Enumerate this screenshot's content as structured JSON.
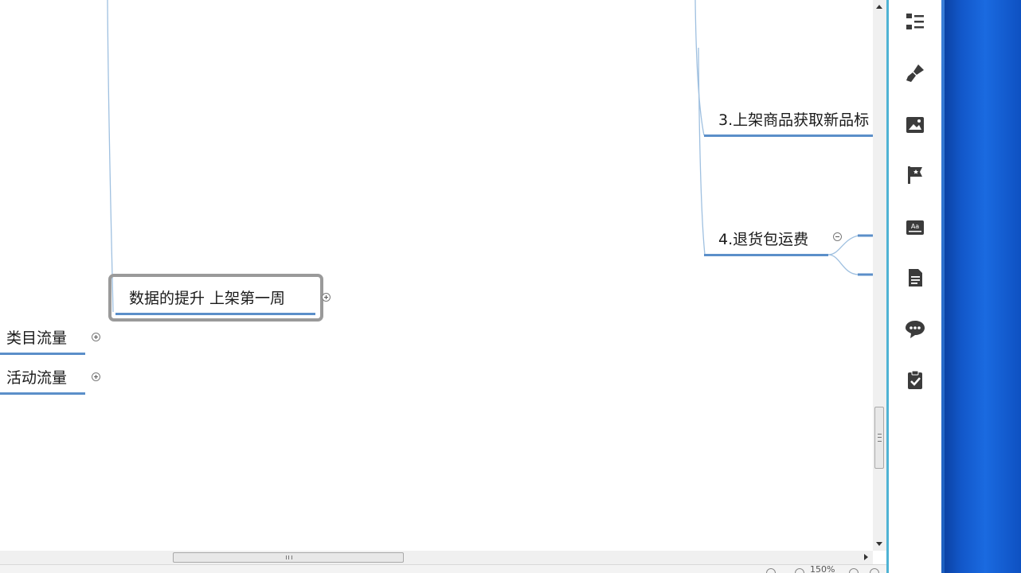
{
  "mindmap": {
    "topics": {
      "central": "数据的提升  上架第一周",
      "category_traffic": "类目流量",
      "activity_traffic": "活动流量",
      "item3": "3.上架商品获取新品标",
      "item4": "4.退货包运费"
    }
  },
  "statusbar": {
    "zoom": "150%"
  },
  "panel": {
    "icons": [
      "outline-icon",
      "format-brush-icon",
      "image-icon",
      "marker-flag-icon",
      "text-style-icon",
      "notes-icon",
      "comments-icon",
      "task-icon"
    ]
  },
  "colors": {
    "branch_line": "#5b8fc9",
    "panel_border": "#4fb3d4",
    "selection_border": "#9a9a9a"
  }
}
